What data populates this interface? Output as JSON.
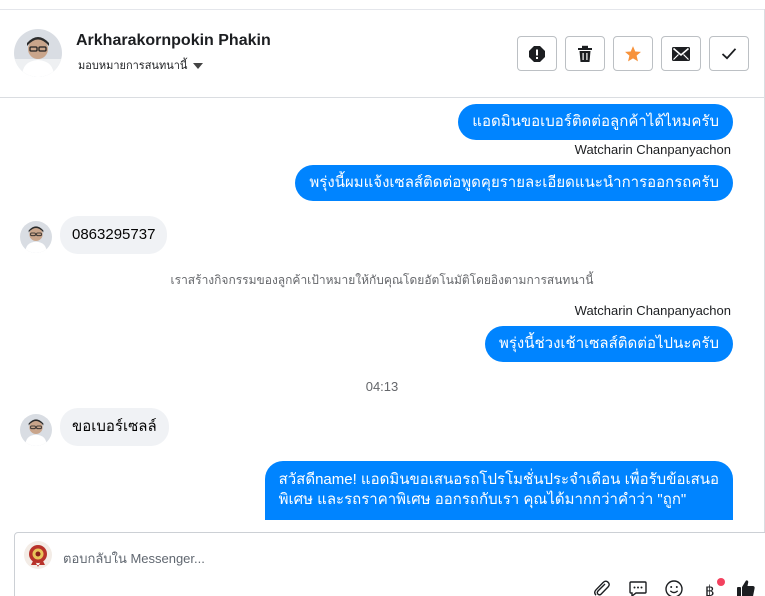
{
  "header": {
    "contact_name": "Arkharakornpokin Phakin",
    "assign_label": "มอบหมายการสนทนานี้",
    "actions": [
      {
        "icon": "alert-icon",
        "label": "spam"
      },
      {
        "icon": "trash-icon",
        "label": "delete"
      },
      {
        "icon": "star-icon",
        "label": "star",
        "color": "#f7923b"
      },
      {
        "icon": "envelope-icon",
        "label": "mark-unread"
      },
      {
        "icon": "check-icon",
        "label": "done"
      }
    ]
  },
  "messages": {
    "m1": "แอดมินขอเบอร์ติดต่อลูกค้าได้ไหมครับ",
    "sender1": "Watcharin Chanpanyachon",
    "m2": "พรุ่งนี้ผมแจ้งเซลส์ติดต่อพูดคุยรายละเอียดแนะนำการออกรถครับ",
    "m3": "0863295737",
    "system1": "เราสร้างกิจกรรมของลูกค้าเป้าหมายให้กับคุณโดยอัตโนมัติโดยอิงตามการสนทนานี้",
    "sender2": "Watcharin Chanpanyachon",
    "m4": "พรุ่งนี้ช่วงเช้าเซลส์ติดต่อไปนะครับ",
    "time1": "04:13",
    "m5": "ขอเบอร์เซลล์",
    "m6_line1": "สวัสดีname! แอดมินขอเสนอรถโปรโมชั่นประจำเดือน เพื่อรับข้อเสนอ",
    "m6_line2": "พิเศษ และรถราคาพิเศษ ออกรถกับเรา คุณได้มากกว่าคำว่า \"ถูก\""
  },
  "composer": {
    "placeholder": "ตอบกลับใน Messenger...",
    "tools": [
      "paperclip-icon",
      "saved-reply-icon",
      "emoji-icon",
      "payment-icon",
      "thumbs-up-icon"
    ]
  },
  "colors": {
    "outgoing": "#0084ff",
    "incoming": "#f0f2f5",
    "star": "#f7923b",
    "notification_dot": "#f3425f"
  }
}
